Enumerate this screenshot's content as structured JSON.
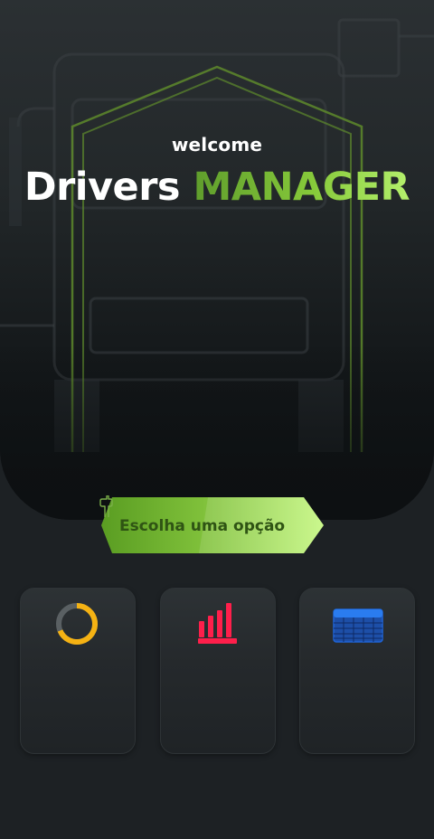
{
  "header": {
    "welcome": "welcome",
    "title_main": "Drivers",
    "title_accent": "MANAGER"
  },
  "cta": {
    "label": "Escolha uma opção",
    "icon": "pointing-hand-icon"
  },
  "colors": {
    "accent_green": "#8cd13e",
    "donut_orange": "#f5b213",
    "bars_red": "#ff1f4b",
    "calendar_blue": "#1e64d8"
  },
  "cards": [
    {
      "icon": "donut-chart-icon"
    },
    {
      "icon": "bar-chart-icon"
    },
    {
      "icon": "table-grid-icon"
    }
  ]
}
